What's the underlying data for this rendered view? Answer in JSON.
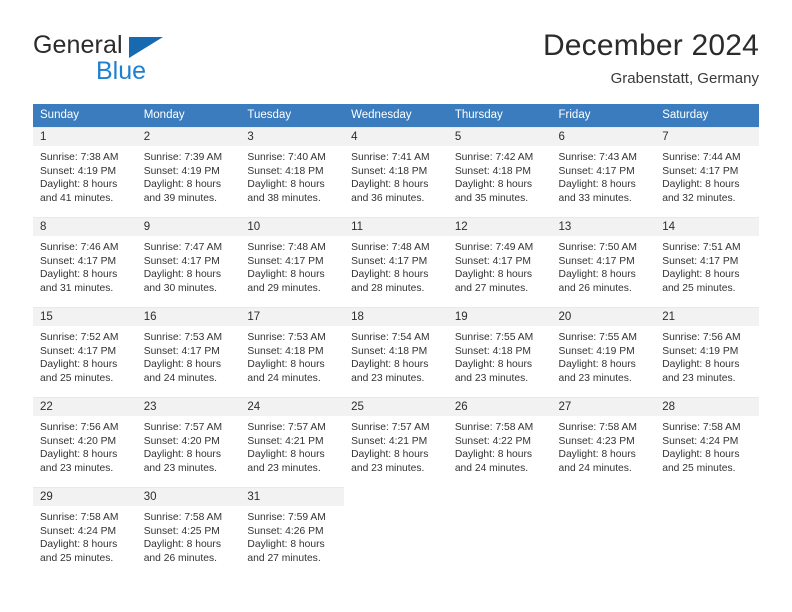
{
  "brand": {
    "line1": "General",
    "line2": "Blue",
    "triangle_color": "#1769b0"
  },
  "header": {
    "title": "December 2024",
    "subtitle": "Grabenstatt, Germany"
  },
  "theme": {
    "header_blue": "#3a7cbd",
    "daynum_band": "#f2f2f2",
    "row_divider": "#e9e9e9",
    "text": "#333333"
  },
  "calendar": {
    "weekday_headers": [
      "Sunday",
      "Monday",
      "Tuesday",
      "Wednesday",
      "Thursday",
      "Friday",
      "Saturday"
    ],
    "weeks": [
      [
        {
          "day": "1",
          "sunrise": "Sunrise: 7:38 AM",
          "sunset": "Sunset: 4:19 PM",
          "daylight1": "Daylight: 8 hours",
          "daylight2": "and 41 minutes."
        },
        {
          "day": "2",
          "sunrise": "Sunrise: 7:39 AM",
          "sunset": "Sunset: 4:19 PM",
          "daylight1": "Daylight: 8 hours",
          "daylight2": "and 39 minutes."
        },
        {
          "day": "3",
          "sunrise": "Sunrise: 7:40 AM",
          "sunset": "Sunset: 4:18 PM",
          "daylight1": "Daylight: 8 hours",
          "daylight2": "and 38 minutes."
        },
        {
          "day": "4",
          "sunrise": "Sunrise: 7:41 AM",
          "sunset": "Sunset: 4:18 PM",
          "daylight1": "Daylight: 8 hours",
          "daylight2": "and 36 minutes."
        },
        {
          "day": "5",
          "sunrise": "Sunrise: 7:42 AM",
          "sunset": "Sunset: 4:18 PM",
          "daylight1": "Daylight: 8 hours",
          "daylight2": "and 35 minutes."
        },
        {
          "day": "6",
          "sunrise": "Sunrise: 7:43 AM",
          "sunset": "Sunset: 4:17 PM",
          "daylight1": "Daylight: 8 hours",
          "daylight2": "and 33 minutes."
        },
        {
          "day": "7",
          "sunrise": "Sunrise: 7:44 AM",
          "sunset": "Sunset: 4:17 PM",
          "daylight1": "Daylight: 8 hours",
          "daylight2": "and 32 minutes."
        }
      ],
      [
        {
          "day": "8",
          "sunrise": "Sunrise: 7:46 AM",
          "sunset": "Sunset: 4:17 PM",
          "daylight1": "Daylight: 8 hours",
          "daylight2": "and 31 minutes."
        },
        {
          "day": "9",
          "sunrise": "Sunrise: 7:47 AM",
          "sunset": "Sunset: 4:17 PM",
          "daylight1": "Daylight: 8 hours",
          "daylight2": "and 30 minutes."
        },
        {
          "day": "10",
          "sunrise": "Sunrise: 7:48 AM",
          "sunset": "Sunset: 4:17 PM",
          "daylight1": "Daylight: 8 hours",
          "daylight2": "and 29 minutes."
        },
        {
          "day": "11",
          "sunrise": "Sunrise: 7:48 AM",
          "sunset": "Sunset: 4:17 PM",
          "daylight1": "Daylight: 8 hours",
          "daylight2": "and 28 minutes."
        },
        {
          "day": "12",
          "sunrise": "Sunrise: 7:49 AM",
          "sunset": "Sunset: 4:17 PM",
          "daylight1": "Daylight: 8 hours",
          "daylight2": "and 27 minutes."
        },
        {
          "day": "13",
          "sunrise": "Sunrise: 7:50 AM",
          "sunset": "Sunset: 4:17 PM",
          "daylight1": "Daylight: 8 hours",
          "daylight2": "and 26 minutes."
        },
        {
          "day": "14",
          "sunrise": "Sunrise: 7:51 AM",
          "sunset": "Sunset: 4:17 PM",
          "daylight1": "Daylight: 8 hours",
          "daylight2": "and 25 minutes."
        }
      ],
      [
        {
          "day": "15",
          "sunrise": "Sunrise: 7:52 AM",
          "sunset": "Sunset: 4:17 PM",
          "daylight1": "Daylight: 8 hours",
          "daylight2": "and 25 minutes."
        },
        {
          "day": "16",
          "sunrise": "Sunrise: 7:53 AM",
          "sunset": "Sunset: 4:17 PM",
          "daylight1": "Daylight: 8 hours",
          "daylight2": "and 24 minutes."
        },
        {
          "day": "17",
          "sunrise": "Sunrise: 7:53 AM",
          "sunset": "Sunset: 4:18 PM",
          "daylight1": "Daylight: 8 hours",
          "daylight2": "and 24 minutes."
        },
        {
          "day": "18",
          "sunrise": "Sunrise: 7:54 AM",
          "sunset": "Sunset: 4:18 PM",
          "daylight1": "Daylight: 8 hours",
          "daylight2": "and 23 minutes."
        },
        {
          "day": "19",
          "sunrise": "Sunrise: 7:55 AM",
          "sunset": "Sunset: 4:18 PM",
          "daylight1": "Daylight: 8 hours",
          "daylight2": "and 23 minutes."
        },
        {
          "day": "20",
          "sunrise": "Sunrise: 7:55 AM",
          "sunset": "Sunset: 4:19 PM",
          "daylight1": "Daylight: 8 hours",
          "daylight2": "and 23 minutes."
        },
        {
          "day": "21",
          "sunrise": "Sunrise: 7:56 AM",
          "sunset": "Sunset: 4:19 PM",
          "daylight1": "Daylight: 8 hours",
          "daylight2": "and 23 minutes."
        }
      ],
      [
        {
          "day": "22",
          "sunrise": "Sunrise: 7:56 AM",
          "sunset": "Sunset: 4:20 PM",
          "daylight1": "Daylight: 8 hours",
          "daylight2": "and 23 minutes."
        },
        {
          "day": "23",
          "sunrise": "Sunrise: 7:57 AM",
          "sunset": "Sunset: 4:20 PM",
          "daylight1": "Daylight: 8 hours",
          "daylight2": "and 23 minutes."
        },
        {
          "day": "24",
          "sunrise": "Sunrise: 7:57 AM",
          "sunset": "Sunset: 4:21 PM",
          "daylight1": "Daylight: 8 hours",
          "daylight2": "and 23 minutes."
        },
        {
          "day": "25",
          "sunrise": "Sunrise: 7:57 AM",
          "sunset": "Sunset: 4:21 PM",
          "daylight1": "Daylight: 8 hours",
          "daylight2": "and 23 minutes."
        },
        {
          "day": "26",
          "sunrise": "Sunrise: 7:58 AM",
          "sunset": "Sunset: 4:22 PM",
          "daylight1": "Daylight: 8 hours",
          "daylight2": "and 24 minutes."
        },
        {
          "day": "27",
          "sunrise": "Sunrise: 7:58 AM",
          "sunset": "Sunset: 4:23 PM",
          "daylight1": "Daylight: 8 hours",
          "daylight2": "and 24 minutes."
        },
        {
          "day": "28",
          "sunrise": "Sunrise: 7:58 AM",
          "sunset": "Sunset: 4:24 PM",
          "daylight1": "Daylight: 8 hours",
          "daylight2": "and 25 minutes."
        }
      ],
      [
        {
          "day": "29",
          "sunrise": "Sunrise: 7:58 AM",
          "sunset": "Sunset: 4:24 PM",
          "daylight1": "Daylight: 8 hours",
          "daylight2": "and 25 minutes."
        },
        {
          "day": "30",
          "sunrise": "Sunrise: 7:58 AM",
          "sunset": "Sunset: 4:25 PM",
          "daylight1": "Daylight: 8 hours",
          "daylight2": "and 26 minutes."
        },
        {
          "day": "31",
          "sunrise": "Sunrise: 7:59 AM",
          "sunset": "Sunset: 4:26 PM",
          "daylight1": "Daylight: 8 hours",
          "daylight2": "and 27 minutes."
        },
        {
          "day": "",
          "sunrise": "",
          "sunset": "",
          "daylight1": "",
          "daylight2": ""
        },
        {
          "day": "",
          "sunrise": "",
          "sunset": "",
          "daylight1": "",
          "daylight2": ""
        },
        {
          "day": "",
          "sunrise": "",
          "sunset": "",
          "daylight1": "",
          "daylight2": ""
        },
        {
          "day": "",
          "sunrise": "",
          "sunset": "",
          "daylight1": "",
          "daylight2": ""
        }
      ]
    ]
  }
}
